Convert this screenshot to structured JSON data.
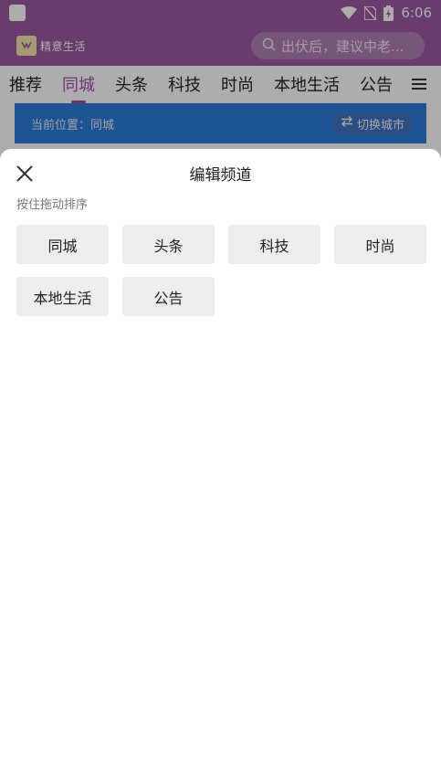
{
  "status_bar": {
    "time": "6:06",
    "icons": [
      "app-icon",
      "wifi-icon",
      "no-sim-icon",
      "battery-charging-icon"
    ]
  },
  "header": {
    "logo_text": "精意生活",
    "search_placeholder": "出伏后，建议中老..."
  },
  "tabs": {
    "items": [
      "推荐",
      "同城",
      "头条",
      "科技",
      "时尚",
      "本地生活",
      "公告"
    ],
    "active": "同城",
    "menu_icon": "menu-icon"
  },
  "banner": {
    "location_text": "当前位置：同城",
    "switch_label": "切换城市"
  },
  "sheet": {
    "title": "编辑频道",
    "hint": "按住拖动排序",
    "channels": [
      "同城",
      "头条",
      "科技",
      "时尚",
      "本地生活",
      "公告"
    ]
  },
  "colors": {
    "brand_purple": "#9c59a1",
    "active_tab": "#a04ea6",
    "banner_blue": "#2f7ad8",
    "chip_bg": "#ededed"
  }
}
